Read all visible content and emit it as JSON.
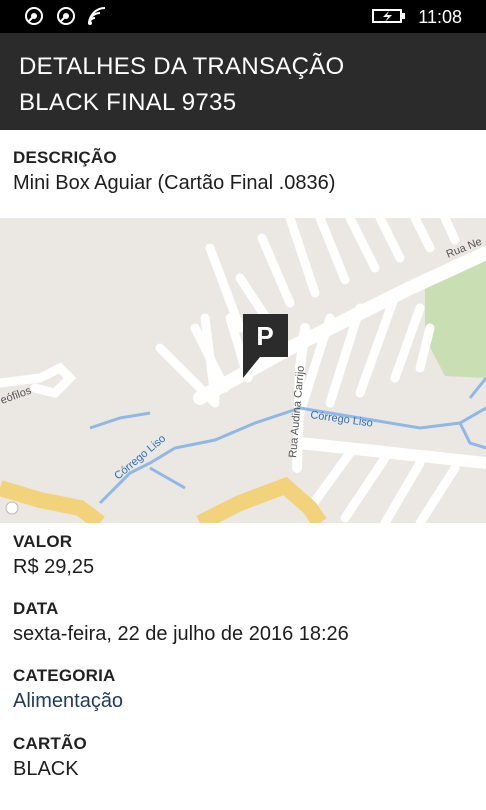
{
  "status_bar": {
    "time": "11:08",
    "icons": [
      "notification-icon",
      "notification-icon",
      "wifi-icon",
      "battery-charging-icon"
    ]
  },
  "header": {
    "title": "DETALHES DA TRANSAÇÃO",
    "subtitle": "BLACK FINAL 9735"
  },
  "description": {
    "label": "DESCRIÇÃO",
    "value": "Mini Box Aguiar (Cartão Final .0836)"
  },
  "map": {
    "marker_letter": "P",
    "street_labels": [
      "Rua Ne",
      "Córrego Liso",
      "Córrego Liso",
      "Rua Audina Carrijo",
      "eófilos"
    ],
    "colors": {
      "background": "#ebe7e2",
      "road": "#ffffff",
      "highway": "#f2d27a",
      "water": "#8fb8e6",
      "park": "#c9dfb3",
      "marker": "#2b2b2b"
    }
  },
  "valor": {
    "label": "VALOR",
    "value": "R$ 29,25"
  },
  "data": {
    "label": "DATA",
    "value": "sexta-feira, 22 de julho de 2016 18:26"
  },
  "categoria": {
    "label": "CATEGORIA",
    "value": "Alimentação"
  },
  "cartao": {
    "label": "CARTÃO",
    "value": "BLACK"
  }
}
